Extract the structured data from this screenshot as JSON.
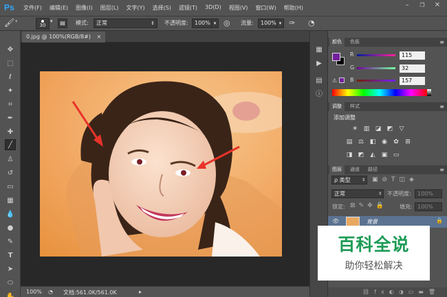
{
  "app": {
    "logo": "Ps"
  },
  "menu": [
    "文件(F)",
    "编辑(E)",
    "图像(I)",
    "图层(L)",
    "文字(Y)",
    "选择(S)",
    "滤镜(T)",
    "3D(D)",
    "视图(V)",
    "窗口(W)",
    "帮助(H)"
  ],
  "window_controls": [
    "minimize-icon",
    "restore-icon",
    "close-icon"
  ],
  "options_bar": {
    "brush_size": "30",
    "mode_label": "模式:",
    "mode_value": "正常",
    "opacity_label": "不透明度:",
    "opacity_value": "100%",
    "flow_label": "流量:",
    "flow_value": "100%"
  },
  "document": {
    "tab_title": "0.jpg @ 100%(RGB/8#)",
    "zoom": "100%",
    "doc_info": "文档:561.0K/561.0K"
  },
  "color_panel": {
    "tabs": [
      "颜色",
      "色板"
    ],
    "channels": [
      {
        "label": "R",
        "value": "115"
      },
      {
        "label": "G",
        "value": "32"
      },
      {
        "label": "B",
        "value": "157"
      }
    ],
    "foreground": "#73209d"
  },
  "adjust_panel": {
    "tabs": [
      "调整",
      "样式"
    ],
    "title": "添加调整"
  },
  "layers_panel": {
    "tabs": [
      "图层",
      "通道",
      "路径"
    ],
    "filter": "ρ 类型",
    "blend_mode": "正常",
    "opacity_label": "不透明度:",
    "opacity_value": "100%",
    "lock_label": "锁定:",
    "fill_label": "填充:",
    "fill_value": "100%",
    "layer_name": "背景"
  },
  "watermark": {
    "title": "百科全说",
    "subtitle": "助你轻松解决"
  },
  "colors": {
    "accent": "#31a8ff",
    "layer_selected": "#5b7391",
    "watermark_green": "#1d9b56",
    "annotation_red": "#e8332a"
  }
}
